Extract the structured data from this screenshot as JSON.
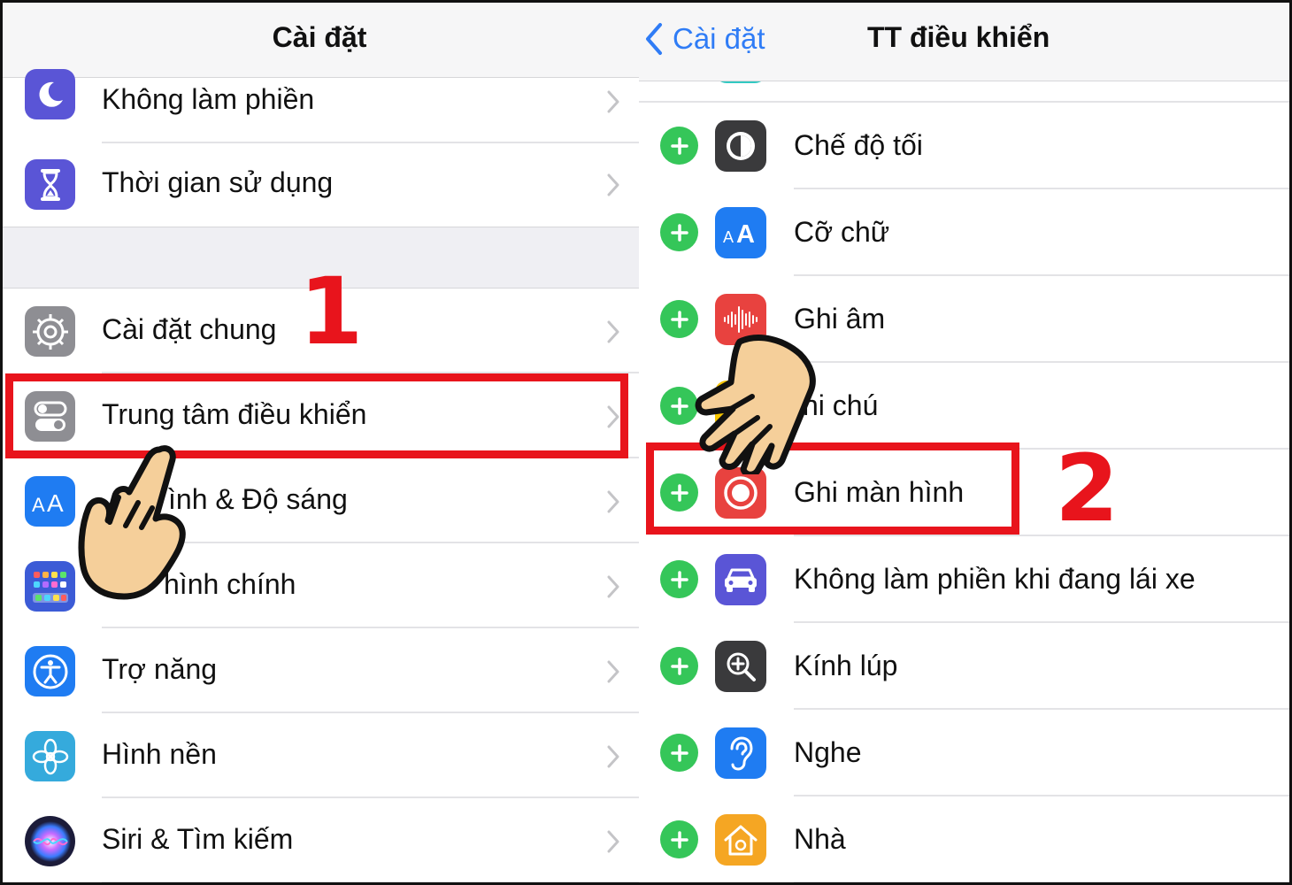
{
  "left": {
    "title": "Cài đặt",
    "items": [
      {
        "label": "Không làm phiền",
        "icon": "moon-icon",
        "color": "#5a55d6"
      },
      {
        "label": "Thời gian sử dụng",
        "icon": "hourglass-icon",
        "color": "#5a55d6"
      },
      {
        "label": "Cài đặt chung",
        "icon": "gear-icon",
        "color": "#8e8e93"
      },
      {
        "label": "Trung tâm điều khiển",
        "icon": "toggle-switches-icon",
        "color": "#8e8e93"
      },
      {
        "label": "ình & Độ sáng",
        "icon": "text-size-icon",
        "color": "#1f7cf2"
      },
      {
        "label": "hình chính",
        "icon": "home-grid-icon",
        "color": "#3c5bd6"
      },
      {
        "label": "Trợ năng",
        "icon": "accessibility-icon",
        "color": "#1f7cf2"
      },
      {
        "label": "Hình nền",
        "icon": "flower-icon",
        "color": "#35aadc"
      },
      {
        "label": "Siri & Tìm kiếm",
        "icon": "siri-icon",
        "color": "#1c1c3a"
      }
    ]
  },
  "right": {
    "back_label": "Cài đặt",
    "title": "TT điều khiển",
    "items": [
      {
        "label": "Chế độ tối",
        "icon": "dark-mode-icon",
        "color": "#3a3a3c"
      },
      {
        "label": "Cỡ chữ",
        "icon": "text-size-icon",
        "color": "#1f7cf2"
      },
      {
        "label": "Ghi âm",
        "icon": "voice-memo-icon",
        "color": "#e8423f"
      },
      {
        "label": "hi chú",
        "icon": "notes-icon",
        "color": "#f5c400"
      },
      {
        "label": "Ghi màn hình",
        "icon": "screen-record-icon",
        "color": "#e8423f"
      },
      {
        "label": "Không làm phiền khi đang lái xe",
        "icon": "car-icon",
        "color": "#5a55d6"
      },
      {
        "label": "Kính lúp",
        "icon": "magnifier-icon",
        "color": "#3a3a3c"
      },
      {
        "label": "Nghe",
        "icon": "ear-icon",
        "color": "#1f7cf2"
      },
      {
        "label": "Nhà",
        "icon": "home-icon",
        "color": "#f5a623"
      }
    ]
  },
  "annotations": {
    "step1": "1",
    "step2": "2",
    "accent": "#e8141c"
  }
}
